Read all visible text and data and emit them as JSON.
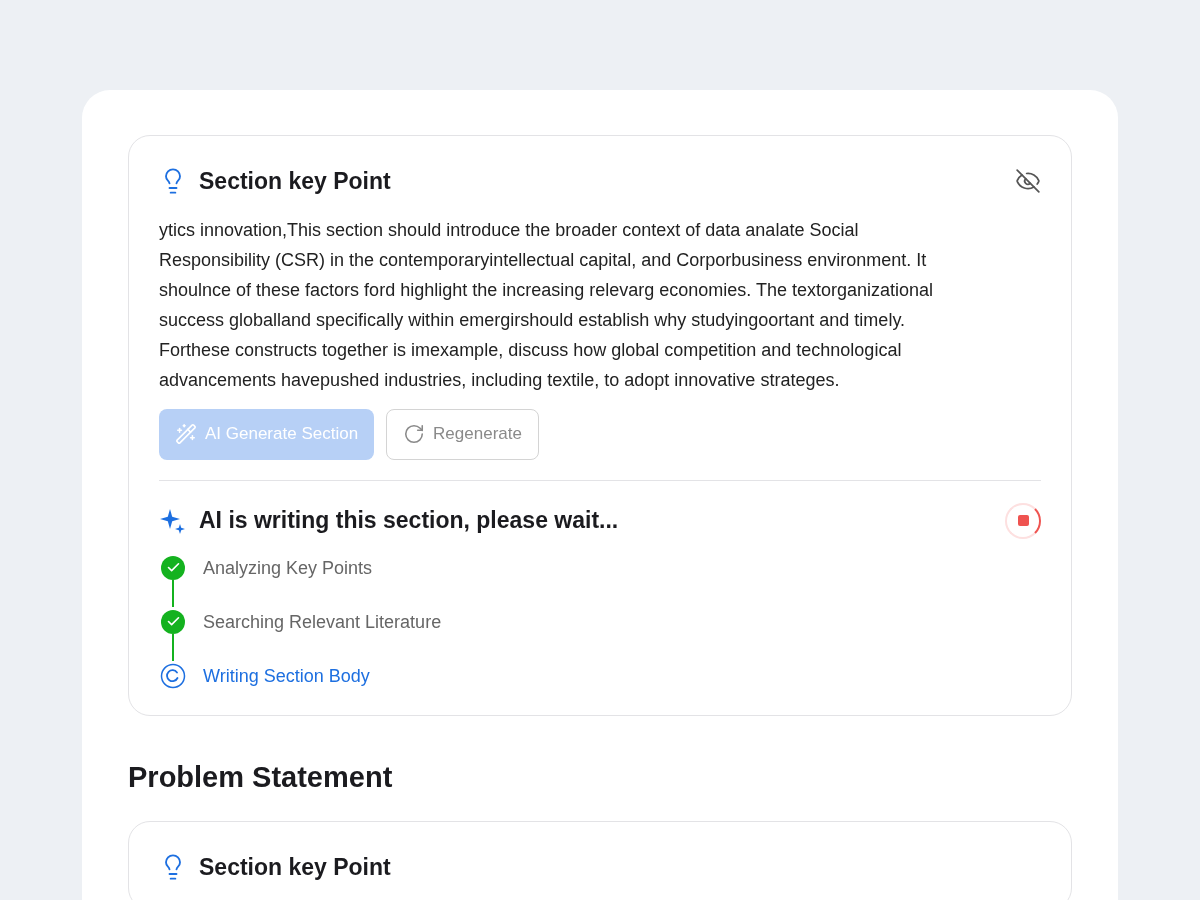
{
  "sections": [
    {
      "key_point": {
        "title": "Section key Point",
        "text": "ytics innovation,This section should introduce the broader context of data analate Social Responsibility (CSR) in the contemporaryintellectual capital, and Corporbusiness environment. It shoulnce of these factors ford highlight the increasing relevarg economies. The textorganizational success globalland specifically within emergirshould establish why studyingoortant and timely. Forthese constructs together is imexample, discuss how global competition and technological advancements havepushed industries, including textile, to adopt innovative strateges."
      },
      "buttons": [
        {
          "label": "AI Generate Section",
          "kind": "generate",
          "disabled": true
        },
        {
          "label": "Regenerate",
          "kind": "regenerate",
          "disabled": true
        }
      ],
      "progress": {
        "title": "AI is writing this section, please wait...",
        "steps": [
          {
            "label": "Analyzing Key Points",
            "completed": true
          },
          {
            "label": "Searching Relevant Literature",
            "completed": true
          },
          {
            "label": "Writing Section Body",
            "completed": false
          }
        ]
      }
    },
    {
      "heading": "Problem Statement",
      "key_point": {
        "title": "Section key Point"
      }
    }
  ]
}
